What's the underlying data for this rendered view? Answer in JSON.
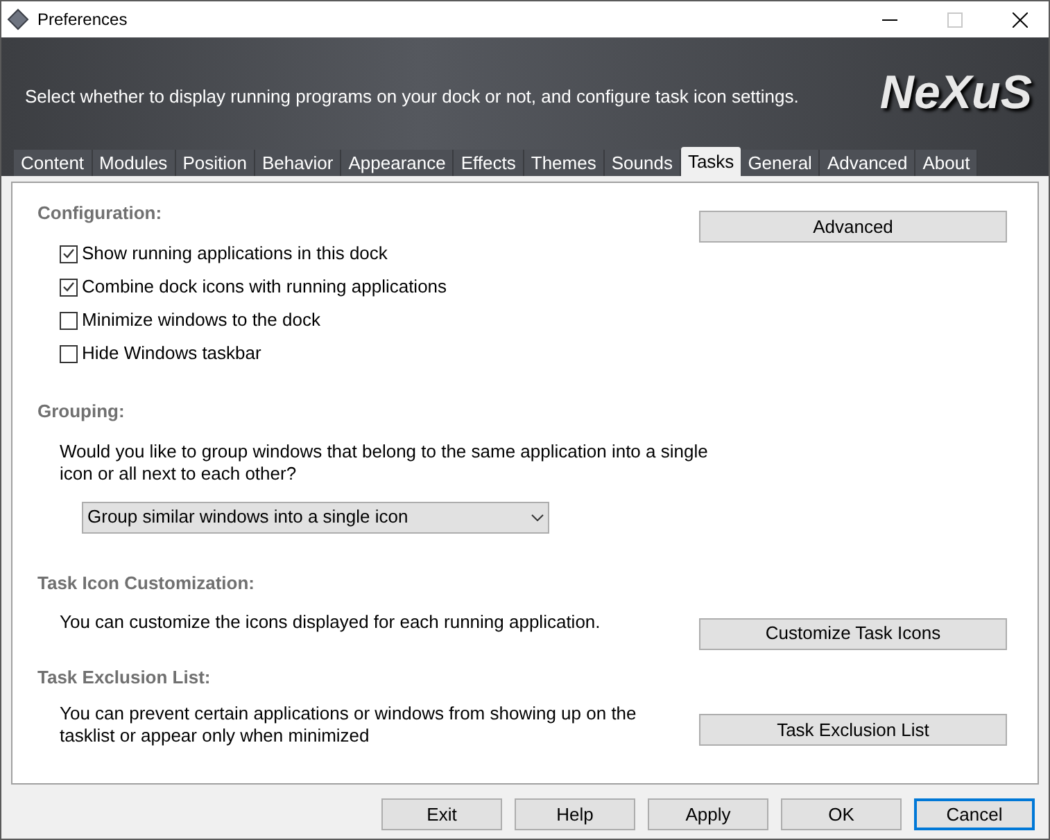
{
  "window": {
    "title": "Preferences"
  },
  "banner": {
    "description": "Select whether to display running programs on your dock or not, and configure task icon settings.",
    "logo": "NeXuS"
  },
  "tabs": [
    {
      "label": "Content",
      "selected": false
    },
    {
      "label": "Modules",
      "selected": false
    },
    {
      "label": "Position",
      "selected": false
    },
    {
      "label": "Behavior",
      "selected": false
    },
    {
      "label": "Appearance",
      "selected": false
    },
    {
      "label": "Effects",
      "selected": false
    },
    {
      "label": "Themes",
      "selected": false
    },
    {
      "label": "Sounds",
      "selected": false
    },
    {
      "label": "Tasks",
      "selected": true
    },
    {
      "label": "General",
      "selected": false
    },
    {
      "label": "Advanced",
      "selected": false
    },
    {
      "label": "About",
      "selected": false
    }
  ],
  "configuration": {
    "heading": "Configuration:",
    "button": "Advanced",
    "options": [
      {
        "label": "Show running applications in this dock",
        "checked": true
      },
      {
        "label": "Combine dock icons with running applications",
        "checked": true
      },
      {
        "label": "Minimize windows to the dock",
        "checked": false
      },
      {
        "label": "Hide Windows taskbar",
        "checked": false
      }
    ]
  },
  "grouping": {
    "heading": "Grouping:",
    "question": "Would you like to group windows that belong to the same application into a single icon or all next to each other?",
    "dropdown": "Group similar windows into a single icon"
  },
  "task_icon_customization": {
    "heading": "Task Icon Customization:",
    "description": "You can customize the icons displayed for each running application.",
    "button": "Customize Task Icons"
  },
  "task_exclusion_list": {
    "heading": "Task Exclusion List:",
    "description": "You can prevent certain applications or windows from showing up on the tasklist or appear only when minimized",
    "button": "Task Exclusion List"
  },
  "buttons": [
    {
      "label": "Exit",
      "focused": false
    },
    {
      "label": "Help",
      "focused": false
    },
    {
      "label": "Apply",
      "focused": false
    },
    {
      "label": "OK",
      "focused": false
    },
    {
      "label": "Cancel",
      "focused": true
    }
  ]
}
